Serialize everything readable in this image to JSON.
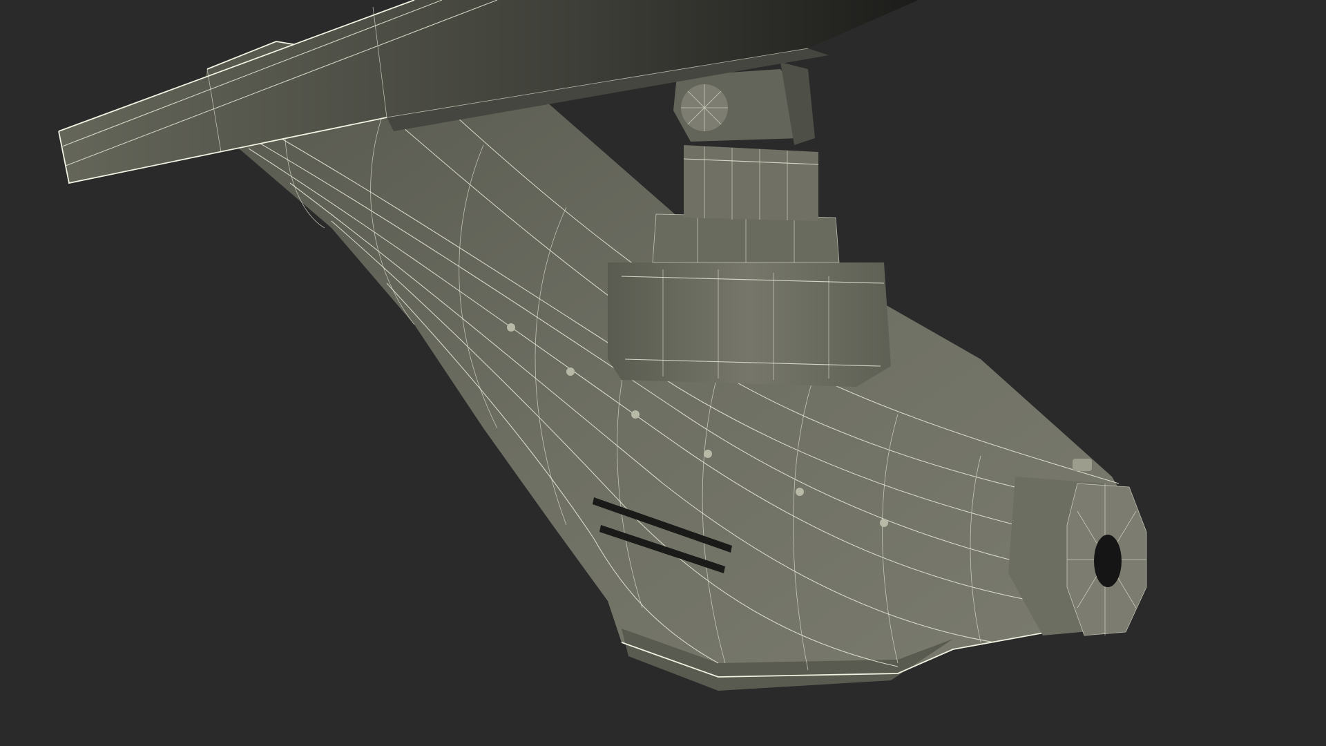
{
  "scene": {
    "subject": "wireframe-render",
    "colors": {
      "background": "#2a2a2a",
      "surface": "#6b6c60",
      "surface_light": "#7a7b6e",
      "surface_dark": "#505148",
      "panel": "#5c5d52",
      "wire": "#e8ead8",
      "hole": "#151515"
    }
  }
}
